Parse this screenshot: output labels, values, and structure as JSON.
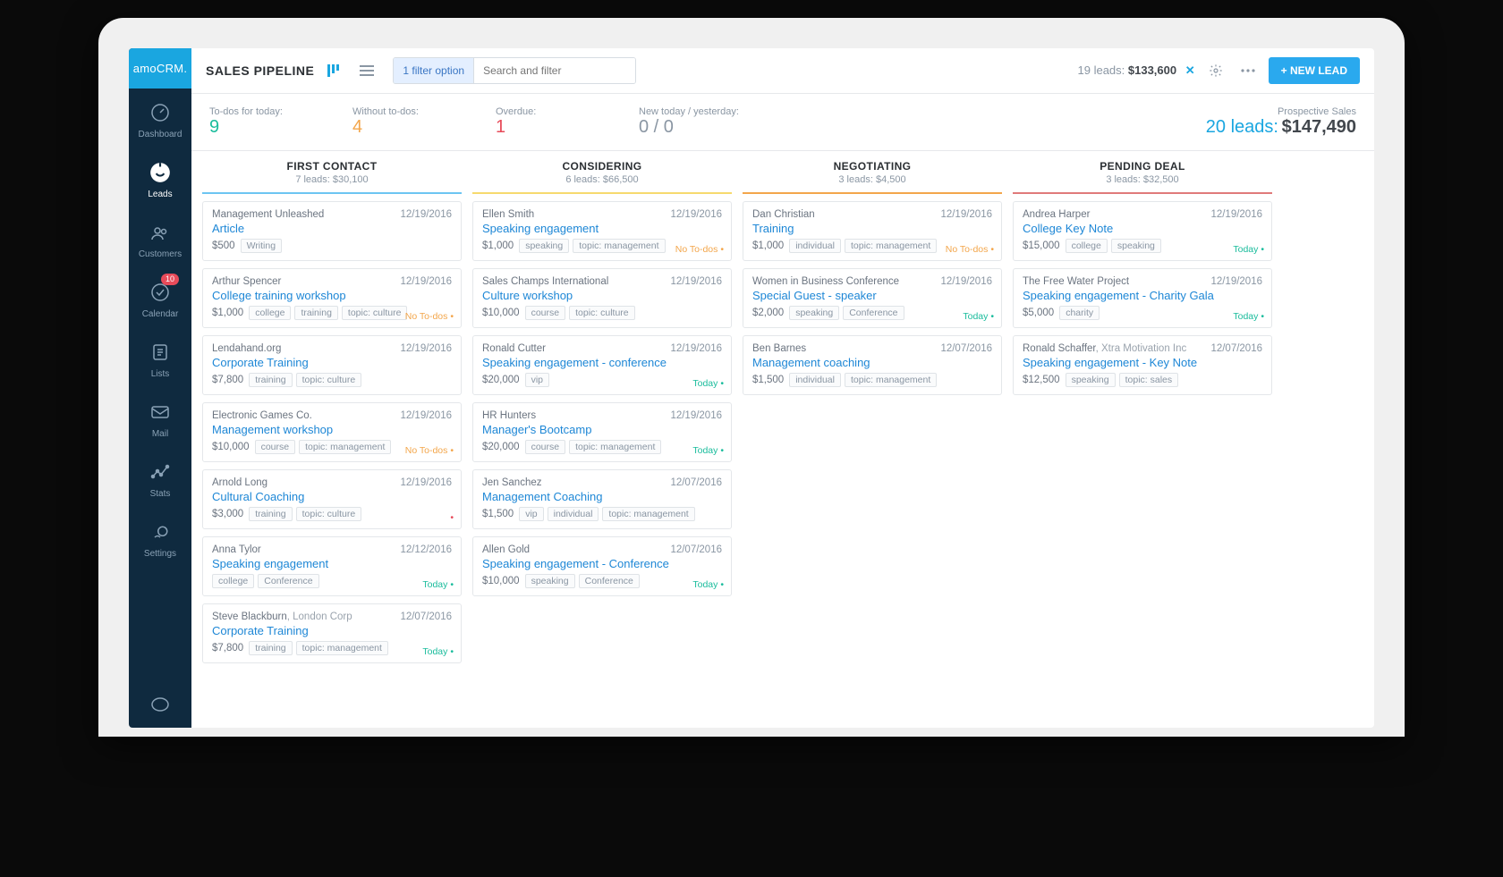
{
  "brand": "amoCRM.",
  "nav": {
    "items": [
      {
        "label": "Dashboard"
      },
      {
        "label": "Leads"
      },
      {
        "label": "Customers"
      },
      {
        "label": "Calendar",
        "badge": "10"
      },
      {
        "label": "Lists"
      },
      {
        "label": "Mail"
      },
      {
        "label": "Stats"
      },
      {
        "label": "Settings"
      }
    ]
  },
  "header": {
    "title": "SALES PIPELINE",
    "filter_chip": "1 filter option",
    "search_placeholder": "Search and filter",
    "summary_leads": "19 leads:",
    "summary_amount": "$133,600",
    "new_lead": "+ NEW LEAD"
  },
  "stats": {
    "today_label": "To-dos for today:",
    "today_value": "9",
    "without_label": "Without to-dos:",
    "without_value": "4",
    "overdue_label": "Overdue:",
    "overdue_value": "1",
    "new_label": "New today / yesterday:",
    "new_value": "0 / 0",
    "prospective_label": "Prospective Sales",
    "prospective_leads": "20 leads:",
    "prospective_amount": "$147,490"
  },
  "columns": [
    {
      "title": "FIRST CONTACT",
      "subtitle": "7 leads: $30,100",
      "cards": [
        {
          "contact": "Management Unleashed",
          "date": "12/19/2016",
          "deal": "Article",
          "amount": "$500",
          "tags": [
            "Writing"
          ]
        },
        {
          "contact": "Arthur Spencer",
          "date": "12/19/2016",
          "deal": "College training workshop",
          "amount": "$1,000",
          "tags": [
            "college",
            "training",
            "topic: culture"
          ],
          "status": "No To-dos",
          "status_type": "notodo"
        },
        {
          "contact": "Lendahand.org",
          "date": "12/19/2016",
          "deal": "Corporate Training",
          "amount": "$7,800",
          "tags": [
            "training",
            "topic: culture"
          ]
        },
        {
          "contact": "Electronic Games Co.",
          "date": "12/19/2016",
          "deal": "Management workshop",
          "amount": "$10,000",
          "tags": [
            "course",
            "topic: management"
          ],
          "status": "No To-dos",
          "status_type": "notodo"
        },
        {
          "contact": "Arnold Long",
          "date": "12/19/2016",
          "deal": "Cultural Coaching",
          "amount": "$3,000",
          "tags": [
            "training",
            "topic: culture"
          ],
          "status": "",
          "status_type": "dot-red"
        },
        {
          "contact": "Anna Tylor",
          "date": "12/12/2016",
          "deal": "Speaking engagement",
          "amount": "",
          "tags": [
            "college",
            "Conference"
          ],
          "status": "Today",
          "status_type": "today"
        },
        {
          "contact": "Steve Blackburn",
          "company": "London Corp",
          "date": "12/07/2016",
          "deal": "Corporate Training",
          "amount": "$7,800",
          "tags": [
            "training",
            "topic: management"
          ],
          "status": "Today",
          "status_type": "today"
        }
      ]
    },
    {
      "title": "CONSIDERING",
      "subtitle": "6 leads: $66,500",
      "cards": [
        {
          "contact": "Ellen Smith",
          "date": "12/19/2016",
          "deal": "Speaking engagement",
          "amount": "$1,000",
          "tags": [
            "speaking",
            "topic: management"
          ],
          "status": "No To-dos",
          "status_type": "notodo"
        },
        {
          "contact": "Sales Champs International",
          "date": "12/19/2016",
          "deal": "Culture workshop",
          "amount": "$10,000",
          "tags": [
            "course",
            "topic: culture"
          ]
        },
        {
          "contact": "Ronald Cutter",
          "date": "12/19/2016",
          "deal": "Speaking engagement - conference",
          "amount": "$20,000",
          "tags": [
            "vip"
          ],
          "status": "Today",
          "status_type": "today"
        },
        {
          "contact": "HR Hunters",
          "date": "12/19/2016",
          "deal": "Manager's Bootcamp",
          "amount": "$20,000",
          "tags": [
            "course",
            "topic: management"
          ],
          "status": "Today",
          "status_type": "today"
        },
        {
          "contact": "Jen Sanchez",
          "date": "12/07/2016",
          "deal": "Management Coaching",
          "amount": "$1,500",
          "tags": [
            "vip",
            "individual",
            "topic: management"
          ]
        },
        {
          "contact": "Allen Gold",
          "date": "12/07/2016",
          "deal": "Speaking engagement - Conference",
          "amount": "$10,000",
          "tags": [
            "speaking",
            "Conference"
          ],
          "status": "Today",
          "status_type": "today"
        }
      ]
    },
    {
      "title": "NEGOTIATING",
      "subtitle": "3 leads: $4,500",
      "cards": [
        {
          "contact": "Dan Christian",
          "date": "12/19/2016",
          "deal": "Training",
          "amount": "$1,000",
          "tags": [
            "individual",
            "topic: management"
          ],
          "status": "No To-dos",
          "status_type": "notodo"
        },
        {
          "contact": "Women in Business Conference",
          "date": "12/19/2016",
          "deal": "Special Guest - speaker",
          "amount": "$2,000",
          "tags": [
            "speaking",
            "Conference"
          ],
          "status": "Today",
          "status_type": "today"
        },
        {
          "contact": "Ben Barnes",
          "date": "12/07/2016",
          "deal": "Management coaching",
          "amount": "$1,500",
          "tags": [
            "individual",
            "topic: management"
          ]
        }
      ]
    },
    {
      "title": "PENDING DEAL",
      "subtitle": "3 leads: $32,500",
      "cards": [
        {
          "contact": "Andrea Harper",
          "date": "12/19/2016",
          "deal": "College Key Note",
          "amount": "$15,000",
          "tags": [
            "college",
            "speaking"
          ],
          "status": "Today",
          "status_type": "today"
        },
        {
          "contact": "The Free Water Project",
          "date": "12/19/2016",
          "deal": "Speaking engagement - Charity Gala",
          "amount": "$5,000",
          "tags": [
            "charity"
          ],
          "status": "Today",
          "status_type": "today"
        },
        {
          "contact": "Ronald Schaffer",
          "company": "Xtra Motivation Inc",
          "date": "12/07/2016",
          "deal": "Speaking engagement - Key Note",
          "amount": "$12,500",
          "tags": [
            "speaking",
            "topic: sales"
          ]
        }
      ]
    }
  ]
}
